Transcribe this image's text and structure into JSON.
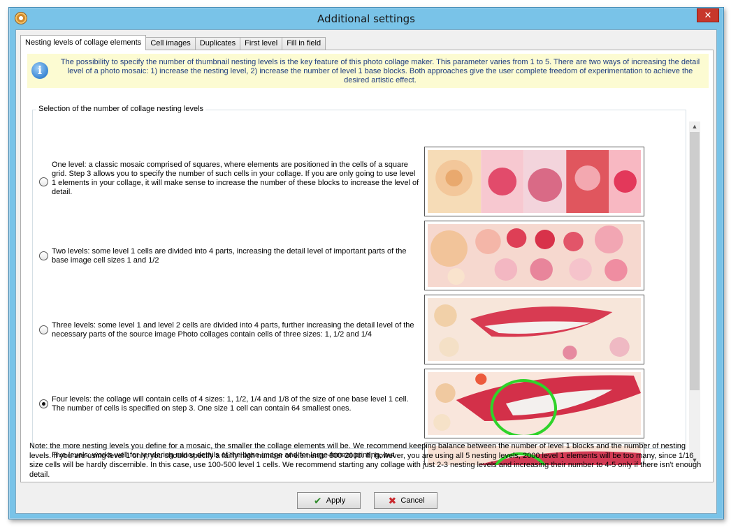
{
  "window": {
    "title": "Additional settings",
    "close_symbol": "✕"
  },
  "tabs": [
    {
      "label": "Nesting levels of collage elements",
      "active": true
    },
    {
      "label": "Cell images",
      "active": false
    },
    {
      "label": "Duplicates",
      "active": false
    },
    {
      "label": "First level",
      "active": false
    },
    {
      "label": "Fill in field",
      "active": false
    }
  ],
  "info": {
    "icon": "info-icon",
    "text": "The possibility to specify the number of thumbnail nesting levels is the key feature of this photo collage maker. This parameter varies from 1 to 5. There are two ways of increasing the detail level of a photo mosaic: 1) increase the nesting level, 2) increase the number of level 1 base blocks. Both approaches give the user complete freedom of experimentation to achieve the desired artistic effect."
  },
  "group": {
    "title": "Selection of the number of collage nesting levels",
    "options": [
      {
        "text": "One level: a classic mosaic comprised of squares, where elements are positioned in the cells of a square grid. Step 3 allows you to specify the number of such cells in your collage. If you are only going to use level 1 elements in your collage, it will make sense to increase the number of these blocks to increase the level of detail.",
        "selected": false
      },
      {
        "text": "Two levels: some level 1 cells are divided into 4 parts, increasing the detail level of important parts of the base image cell sizes 1 and 1/2",
        "selected": false
      },
      {
        "text": "Three levels: some level 1 and level 2 cells are divided into 4 parts, further increasing the detail level of the necessary parts of the source image Photo collages contain cells of three sizes: 1, 1/2 and 1/4",
        "selected": false
      },
      {
        "text": "Four levels: the collage will contain cells of 4 sizes: 1, 1/2, 1/4 and 1/8 of the size of one base level 1 cell. The number of cells is specified on step 3. One size 1 cell can contain 64 smallest ones.",
        "selected": true
      },
      {
        "text": "Five levels: works well for rendering minor details of the base image and for large-format printing, but",
        "selected": false
      }
    ]
  },
  "note": "Note: the more nesting levels you define for a mosaic, the smaller the collage elements will be. We recommend keeping balance between the number of level 1 blocks and the number of nesting levels. If you are using level 1 only, you should specify a fairly high number of elements: 800-2000. If, however, you are using all 5 nesting levels, 2000 level 1 elements will be too many, since 1/16 size cells will be hardly discernible. In this case, use 100-500 level 1 cells. We recommend starting any collage with just 2-3 nesting levels and increasing their number to 4-5 only if there isn't enough detail.",
  "buttons": {
    "apply": "Apply",
    "cancel": "Cancel"
  },
  "colors": {
    "accent": "#79c3e8",
    "info_bg": "#fcfbd2",
    "info_text": "#1f3e80",
    "close": "#c7372b"
  }
}
